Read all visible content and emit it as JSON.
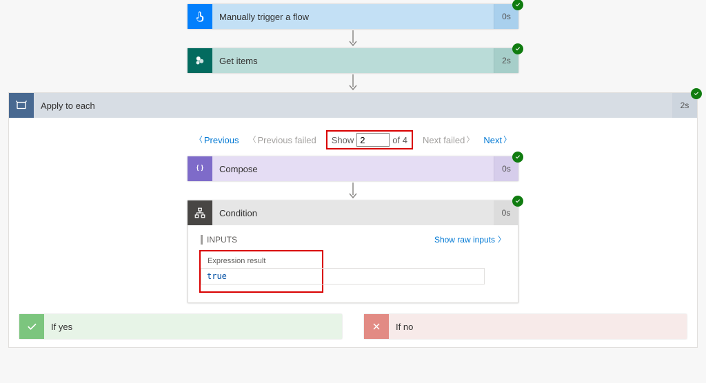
{
  "trigger": {
    "title": "Manually trigger a flow",
    "timing": "0s"
  },
  "get_items": {
    "title": "Get items",
    "timing": "2s"
  },
  "apply_each": {
    "title": "Apply to each",
    "timing": "2s",
    "pager": {
      "previous": "Previous",
      "previous_failed": "Previous failed",
      "show_label": "Show",
      "current": "2",
      "of_text": "of 4",
      "next_failed": "Next failed",
      "next": "Next"
    },
    "compose": {
      "title": "Compose",
      "timing": "0s"
    },
    "condition": {
      "title": "Condition",
      "timing": "0s",
      "inputs_label": "INPUTS",
      "show_raw": "Show raw inputs",
      "expr_label": "Expression result",
      "expr_value": "true"
    },
    "yes_label": "If yes",
    "no_label": "If no"
  }
}
